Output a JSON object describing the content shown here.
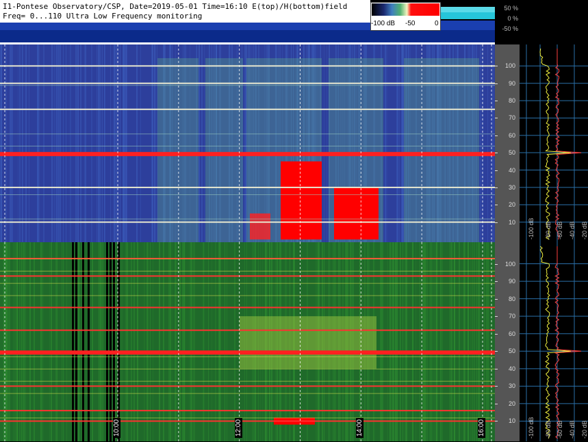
{
  "title": {
    "line1": "I1-Pontese Observatory/CSP, Date=2019-05-01 Time=16:10 E(top)/H(bottom)field",
    "line2": "Freq= 0...110 Ultra Low Frequency monitoring"
  },
  "colorbar": {
    "ticks": [
      "-100 dB",
      "-50",
      "0"
    ],
    "colors": [
      "#000000",
      "#2a3a8a",
      "#3fa060",
      "#f0f0b0",
      "#ff0000"
    ]
  },
  "top_scale": [
    "50 %",
    "0 %",
    "-50 %"
  ],
  "chart_data": {
    "type": "heatmap",
    "title": "I1-Pontese Observatory/CSP, Date=2019-05-01 Time=16:10 E(top)/H(bottom)field",
    "subtitle": "Freq= 0...110 Ultra Low Frequency monitoring",
    "x_time_labels": [
      "10:00",
      "12:00",
      "14:00",
      "16:00"
    ],
    "y_ticks_hz": [
      10,
      20,
      30,
      40,
      50,
      60,
      70,
      80,
      90,
      100
    ],
    "ylim": [
      0,
      110
    ],
    "colorscale_db": [
      -100,
      0
    ],
    "panels": [
      {
        "name": "E field",
        "strong_lines_hz": [
          10,
          30,
          50,
          75,
          90,
          100
        ],
        "peak_line_hz": 50
      },
      {
        "name": "H field",
        "strong_lines_hz": [
          10,
          16,
          30,
          50,
          62,
          75,
          93,
          103
        ],
        "peak_line_hz": 50
      }
    ],
    "profile_db_labels": [
      "-100 dB",
      "-80 dB",
      "-60 dB",
      "-40 dB",
      "-20 dB"
    ]
  }
}
